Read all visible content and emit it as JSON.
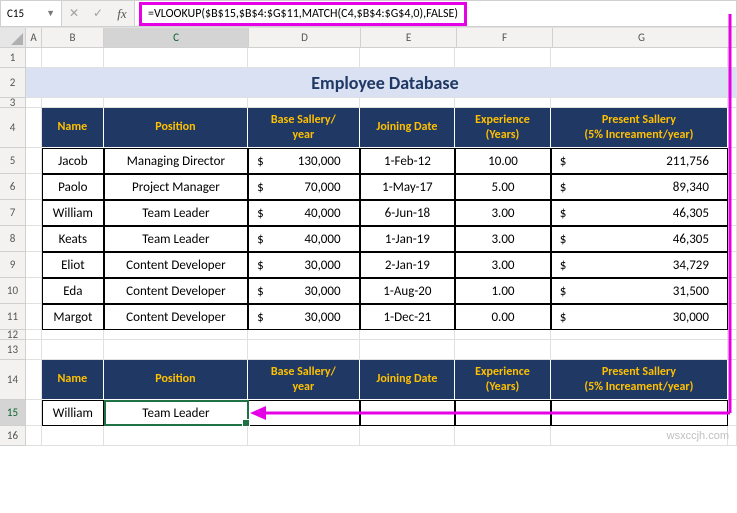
{
  "toolbar": {
    "name_box": "C15",
    "formula": "=VLOOKUP($B$15,$B$4:$G$11,MATCH(C4,$B$4:$G$4,0),FALSE)"
  },
  "columns": [
    "A",
    "B",
    "C",
    "D",
    "E",
    "F",
    "G"
  ],
  "rows": [
    "1",
    "2",
    "3",
    "4",
    "5",
    "6",
    "7",
    "8",
    "9",
    "10",
    "11",
    "12",
    "13",
    "14",
    "15",
    "16"
  ],
  "title": "Employee Database",
  "headers": {
    "name": "Name",
    "position": "Position",
    "base": "Base Sallery/\nyear",
    "joining": "Joining Date",
    "exp": "Experience (Years)",
    "present": "Present Sallery\n(5% Increament/year)"
  },
  "data": [
    {
      "name": "Jacob",
      "pos": "Managing Director",
      "base": "130,000",
      "join": "1-Feb-12",
      "exp": "10.00",
      "sal": "211,756"
    },
    {
      "name": "Paolo",
      "pos": "Project Manager",
      "base": "70,000",
      "join": "1-May-17",
      "exp": "5.00",
      "sal": "89,340"
    },
    {
      "name": "William",
      "pos": "Team Leader",
      "base": "40,000",
      "join": "6-Jun-18",
      "exp": "3.00",
      "sal": "46,305"
    },
    {
      "name": "Keats",
      "pos": "Team Leader",
      "base": "40,000",
      "join": "1-Jan-19",
      "exp": "3.00",
      "sal": "46,305"
    },
    {
      "name": "Eliot",
      "pos": "Content Developer",
      "base": "30,000",
      "join": "2-Jan-19",
      "exp": "3.00",
      "sal": "34,729"
    },
    {
      "name": "Eda",
      "pos": "Content Developer",
      "base": "30,000",
      "join": "1-Aug-20",
      "exp": "1.00",
      "sal": "31,500"
    },
    {
      "name": "Margot",
      "pos": "Content Developer",
      "base": "30,000",
      "join": "1-Dec-21",
      "exp": "0.00",
      "sal": "30,000"
    }
  ],
  "lookup": {
    "name": "William",
    "position": "Team Leader"
  },
  "watermark": "wsxccjh.com"
}
